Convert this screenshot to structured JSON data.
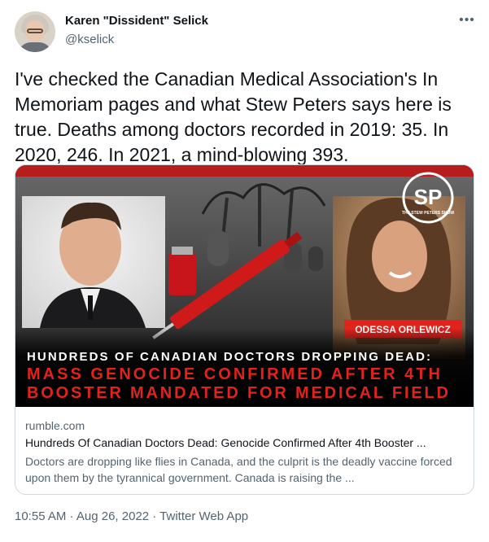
{
  "author": {
    "display_name": "Karen \"Dissident\" Selick",
    "handle": "@kselick"
  },
  "tweet": {
    "text": "I've checked the Canadian Medical Association's In Memoriam pages and what Stew Peters says here is true. Deaths among doctors recorded in 2019: 35. In 2020, 246. In 2021, a mind-blowing 393."
  },
  "menu_icon": "more-horizontal-icon",
  "card": {
    "domain": "rumble.com",
    "title": "Hundreds Of Canadian Doctors Dead: Genocide Confirmed After 4th Booster ...",
    "description": "Doctors are dropping like flies in Canada, and the culprit is the deadly vaccine forced upon them by the tyrannical government. Canada is raising the ...",
    "image": {
      "logo_text": "SP",
      "logo_subtext": "THE STEW PETERS SHOW",
      "name_tag": "ODESSA ORLEWICZ",
      "headline_line1": "HUNDREDS OF CANADIAN DOCTORS DROPPING DEAD:",
      "headline_line2": "MASS GENOCIDE CONFIRMED AFTER 4TH",
      "headline_line3": "BOOSTER MANDATED FOR MEDICAL FIELD"
    }
  },
  "footer": {
    "timestamp": "10:55 AM · Aug 26, 2022 · Twitter Web App"
  },
  "colors": {
    "text_primary": "#0f1419",
    "text_secondary": "#536471",
    "border": "#cfd9de",
    "headline_red": "#e0231c"
  }
}
